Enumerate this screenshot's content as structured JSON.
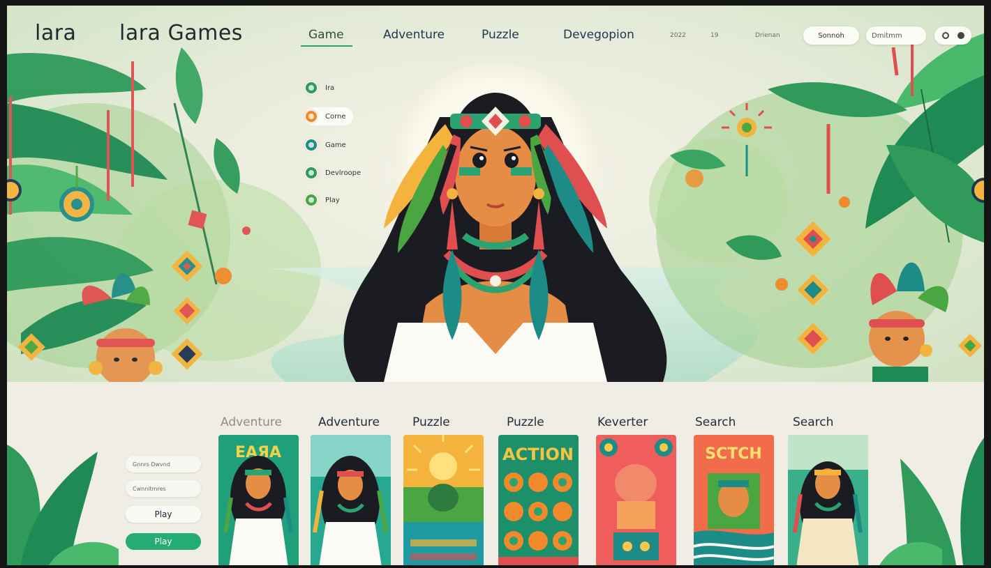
{
  "header": {
    "logo_short": "lara",
    "logo_full": "lara Games",
    "nav": [
      {
        "label": "Game",
        "active": true
      },
      {
        "label": "Adventure",
        "active": false
      },
      {
        "label": "Puzzle",
        "active": false
      },
      {
        "label": "Devegopion",
        "active": false
      }
    ],
    "tiny_a": "2022",
    "tiny_b": "19",
    "tiny_c": "Drienan",
    "search_button": "Sonnoh",
    "search_placeholder": "Dmitmm",
    "icon_left": "settings-icon",
    "icon_right": "profile-icon"
  },
  "side_menu": [
    {
      "label": "Ira",
      "color": "#2f9a5a"
    },
    {
      "label": "Corne",
      "color": "#f08a2a"
    },
    {
      "label": "Game",
      "color": "#1e8c86"
    },
    {
      "label": "Devlroope",
      "color": "#2f9a5a"
    },
    {
      "label": "Play",
      "color": "#4aa640"
    }
  ],
  "categories": [
    {
      "label": "Adventure",
      "faded": true
    },
    {
      "label": "Adventure",
      "faded": false
    },
    {
      "label": "Puzzle",
      "faded": false
    },
    {
      "label": "Puzzle",
      "faded": false
    },
    {
      "label": "Keverter",
      "faded": false
    },
    {
      "label": "Search",
      "faded": false
    },
    {
      "label": "Search",
      "faded": false
    }
  ],
  "cards": [
    {
      "title": "ЕАЯА",
      "bg": "#1fa07a",
      "accent": "#f3d24a"
    },
    {
      "title": "",
      "bg": "#27a890",
      "accent": "#86d3c8"
    },
    {
      "title": "",
      "bg": "#f3b33d",
      "accent": "#ffe07d"
    },
    {
      "title": "ACTION",
      "bg": "#1d8f6a",
      "accent": "#f4c542"
    },
    {
      "title": "",
      "bg": "#ef5d5d",
      "accent": "#f6c94c"
    },
    {
      "title": "SCTCH",
      "bg": "#f26b4a",
      "accent": "#ffe070"
    },
    {
      "title": "",
      "bg": "#39b08a",
      "accent": "#f4e6c2"
    }
  ],
  "side_panel": {
    "field_1": "Gnnrs Dwvnd",
    "field_2": "Cwnnitmres",
    "button_light": "Play",
    "button_green": "Play"
  },
  "colors": {
    "accent_green": "#23ad74",
    "leaf_dark": "#1f8a54",
    "leaf_light": "#49b96b",
    "skin": "#e58c45",
    "hair": "#1b1b22"
  }
}
